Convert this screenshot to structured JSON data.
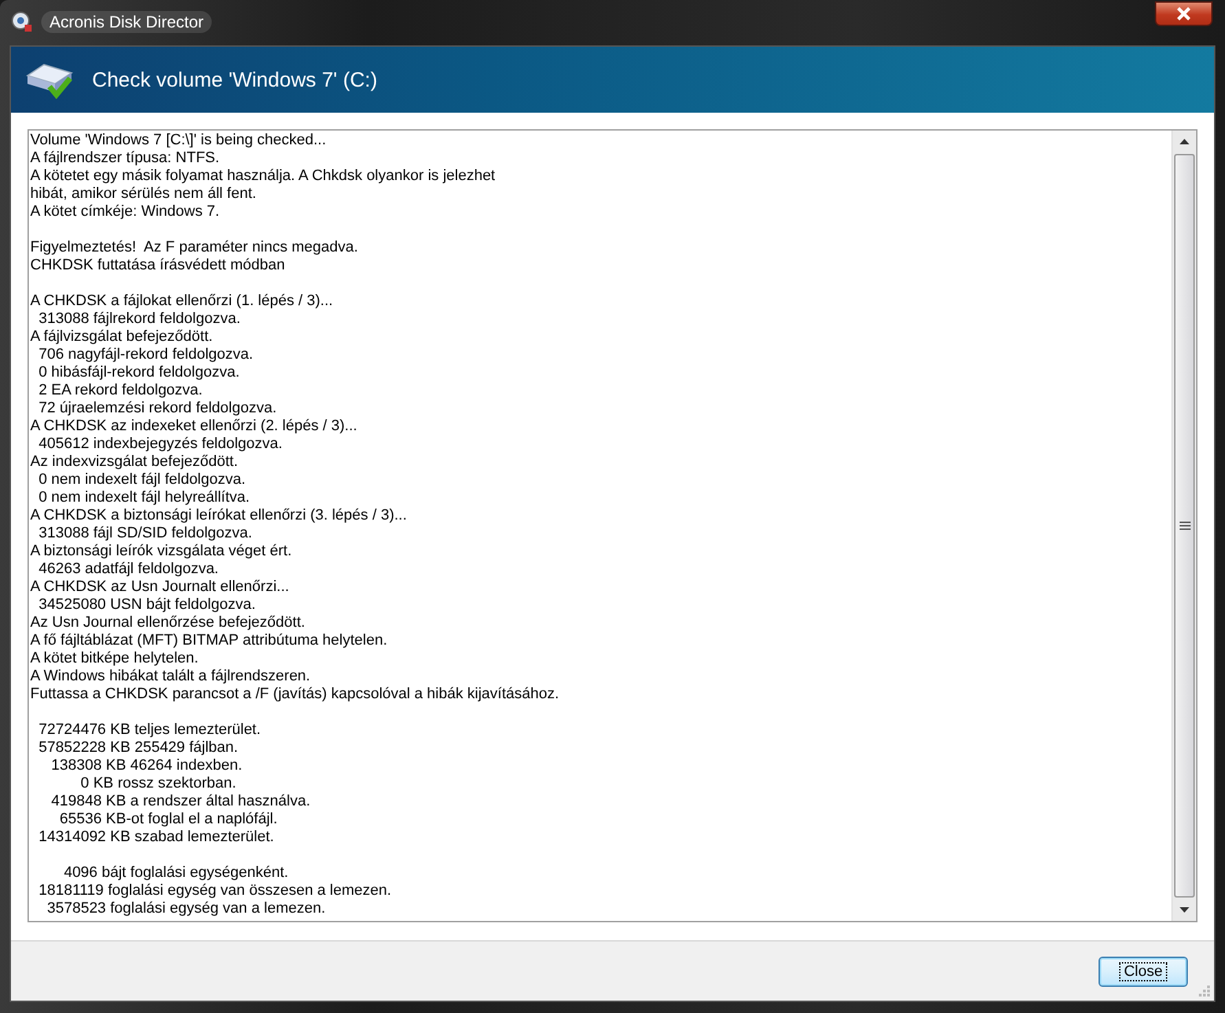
{
  "window": {
    "title": "Acronis Disk Director"
  },
  "header": {
    "title": "Check volume 'Windows 7' (C:)"
  },
  "log": {
    "paragraphs": [
      [
        "Volume 'Windows 7 [C:\\]' is being checked...",
        "A fájlrendszer típusa: NTFS.",
        "A kötetet egy másik folyamat használja. A Chkdsk olyankor is jelezhet",
        "hibát, amikor sérülés nem áll fent.",
        "A kötet címkéje: Windows 7."
      ],
      [
        "Figyelmeztetés!  Az F paraméter nincs megadva.",
        "CHKDSK futtatása írásvédett módban"
      ],
      [
        "A CHKDSK a fájlokat ellenőrzi (1. lépés / 3)...",
        "  313088 fájlrekord feldolgozva.",
        "A fájlvizsgálat befejeződött.",
        "  706 nagyfájl-rekord feldolgozva.",
        "  0 hibásfájl-rekord feldolgozva.",
        "  2 EA rekord feldolgozva.",
        "  72 újraelemzési rekord feldolgozva.",
        "A CHKDSK az indexeket ellenőrzi (2. lépés / 3)...",
        "  405612 indexbejegyzés feldolgozva.",
        "Az indexvizsgálat befejeződött.",
        "  0 nem indexelt fájl feldolgozva.",
        "  0 nem indexelt fájl helyreállítva.",
        "A CHKDSK a biztonsági leírókat ellenőrzi (3. lépés / 3)...",
        "  313088 fájl SD/SID feldolgozva.",
        "A biztonsági leírók vizsgálata véget ért.",
        "  46263 adatfájl feldolgozva.",
        "A CHKDSK az Usn Journalt ellenőrzi...",
        "  34525080 USN bájt feldolgozva.",
        "Az Usn Journal ellenőrzése befejeződött.",
        "A fő fájltáblázat (MFT) BITMAP attribútuma helytelen.",
        "A kötet bitképe helytelen.",
        "A Windows hibákat talált a fájlrendszeren.",
        "Futtassa a CHKDSK parancsot a /F (javítás) kapcsolóval a hibák kijavításához."
      ],
      [
        "  72724476 KB teljes lemezterület.",
        "  57852228 KB 255429 fájlban.",
        "     138308 KB 46264 indexben.",
        "            0 KB rossz szektorban.",
        "     419848 KB a rendszer által használva.",
        "       65536 KB-ot foglal el a naplófájl.",
        "  14314092 KB szabad lemezterület."
      ],
      [
        "        4096 bájt foglalási egységenként.",
        "  18181119 foglalási egység van összesen a lemezen.",
        "    3578523 foglalási egység van a lemezen."
      ]
    ]
  },
  "buttons": [
    {
      "label": "Close"
    }
  ]
}
